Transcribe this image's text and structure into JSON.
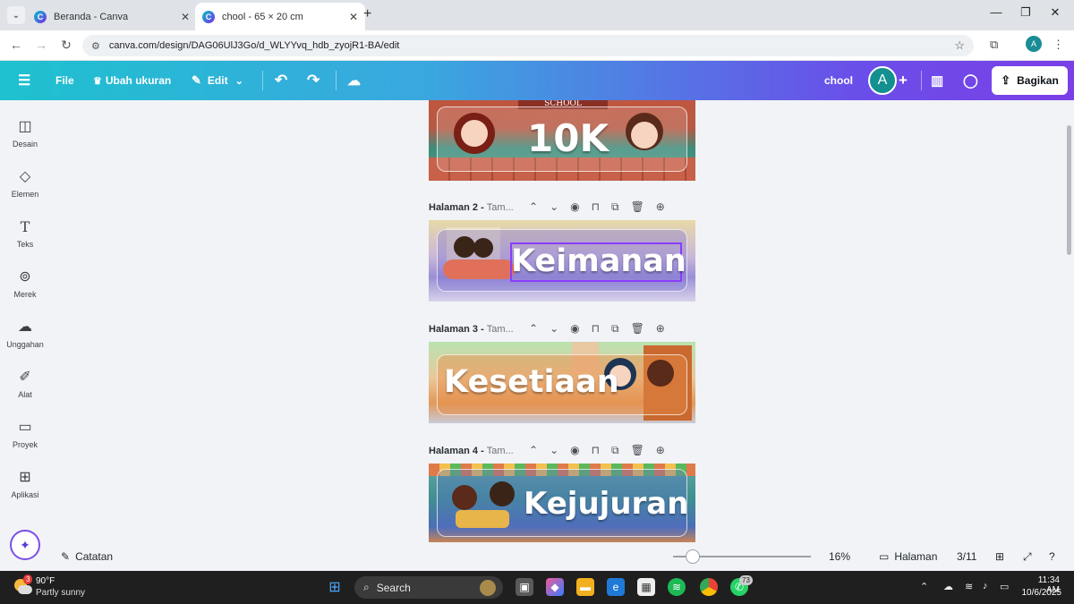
{
  "browser": {
    "tabs": [
      {
        "label": "Beranda - Canva",
        "active": false
      },
      {
        "label": "chool - 65 × 20 cm",
        "active": true
      }
    ],
    "url": "canva.com/design/DAG06UlJ3Go/d_WLYYvq_hdb_zyojR1-BA/edit",
    "profile_initial": "A"
  },
  "header": {
    "file_label": "File",
    "resize_label": "Ubah ukuran",
    "edit_label": "Edit",
    "design_title": "chool",
    "avatar_initial": "A",
    "share_label": "Bagikan"
  },
  "sidebar": {
    "items": [
      {
        "label": "Desain",
        "icon": "layout-icon"
      },
      {
        "label": "Elemen",
        "icon": "shapes-icon"
      },
      {
        "label": "Teks",
        "icon": "text-icon"
      },
      {
        "label": "Merek",
        "icon": "brand-icon"
      },
      {
        "label": "Unggahan",
        "icon": "upload-cloud-icon"
      },
      {
        "label": "Alat",
        "icon": "pen-tool-icon"
      },
      {
        "label": "Proyek",
        "icon": "folder-icon"
      },
      {
        "label": "Aplikasi",
        "icon": "apps-grid-icon"
      }
    ]
  },
  "pages": [
    {
      "header": "",
      "subtitle": "",
      "text": "10K",
      "school_sign": "SCHOOL"
    },
    {
      "header": "Halaman 2 -",
      "subtitle": "Tam...",
      "text": "Keimanan"
    },
    {
      "header": "Halaman 3 -",
      "subtitle": "Tam...",
      "text": "Kesetiaan"
    },
    {
      "header": "Halaman 4 -",
      "subtitle": "Tam...",
      "text": "Kejujuran"
    }
  ],
  "bottom": {
    "notes_label": "Catatan",
    "zoom": "16%",
    "zoom_fraction": 0.16,
    "pages_label": "Halaman",
    "page_counter": "3/11"
  },
  "taskbar": {
    "weather_badge": "3",
    "temperature": "90°F",
    "weather_desc": "Partly sunny",
    "search_label": "Search",
    "whatsapp_badge": "73",
    "time": "11:34 AM",
    "date": "10/6/2025"
  },
  "colors": {
    "header_gradient_start": "#1ec1cf",
    "header_gradient_end": "#7b3fe8",
    "accent": "#7d2ae8"
  }
}
